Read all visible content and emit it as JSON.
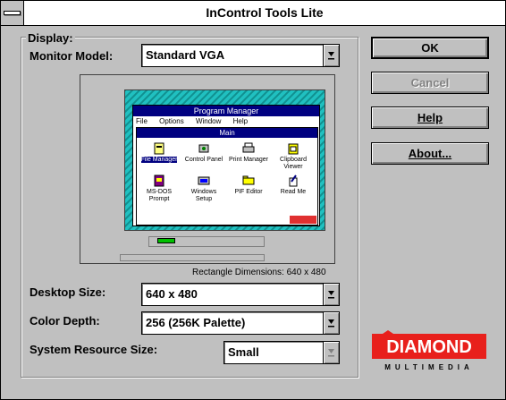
{
  "window": {
    "title": "InControl Tools Lite"
  },
  "display_group": {
    "label": "Display:"
  },
  "monitor_model": {
    "label": "Monitor Model:",
    "value": "Standard VGA"
  },
  "preview": {
    "program_manager_title": "Program Manager",
    "menu_items": [
      "File",
      "Options",
      "Window",
      "Help"
    ],
    "main_title": "Main",
    "icons": [
      {
        "label": "File Manager",
        "icon": "file-manager-icon"
      },
      {
        "label": "Control Panel",
        "icon": "control-panel-icon"
      },
      {
        "label": "Print Manager",
        "icon": "print-manager-icon"
      },
      {
        "label": "Clipboard Viewer",
        "icon": "clipboard-icon"
      },
      {
        "label": "MS-DOS Prompt",
        "icon": "msdos-icon"
      },
      {
        "label": "Windows Setup",
        "icon": "setup-icon"
      },
      {
        "label": "PIF Editor",
        "icon": "pif-icon"
      },
      {
        "label": "Read Me",
        "icon": "readme-icon"
      }
    ]
  },
  "rectangle_dimensions": "Rectangle Dimensions:  640 x 480",
  "desktop_size": {
    "label": "Desktop Size:",
    "value": "640 x 480"
  },
  "color_depth": {
    "label": "Color Depth:",
    "value": "256 (256K Palette)"
  },
  "system_resource": {
    "label": "System Resource Size:",
    "value": "Small"
  },
  "buttons": {
    "ok": "OK",
    "cancel": "Cancel",
    "help": "Help",
    "about": "About..."
  },
  "brand": {
    "name": "DIAMOND",
    "tagline": "MULTIMEDIA",
    "color": "#e8201c"
  }
}
